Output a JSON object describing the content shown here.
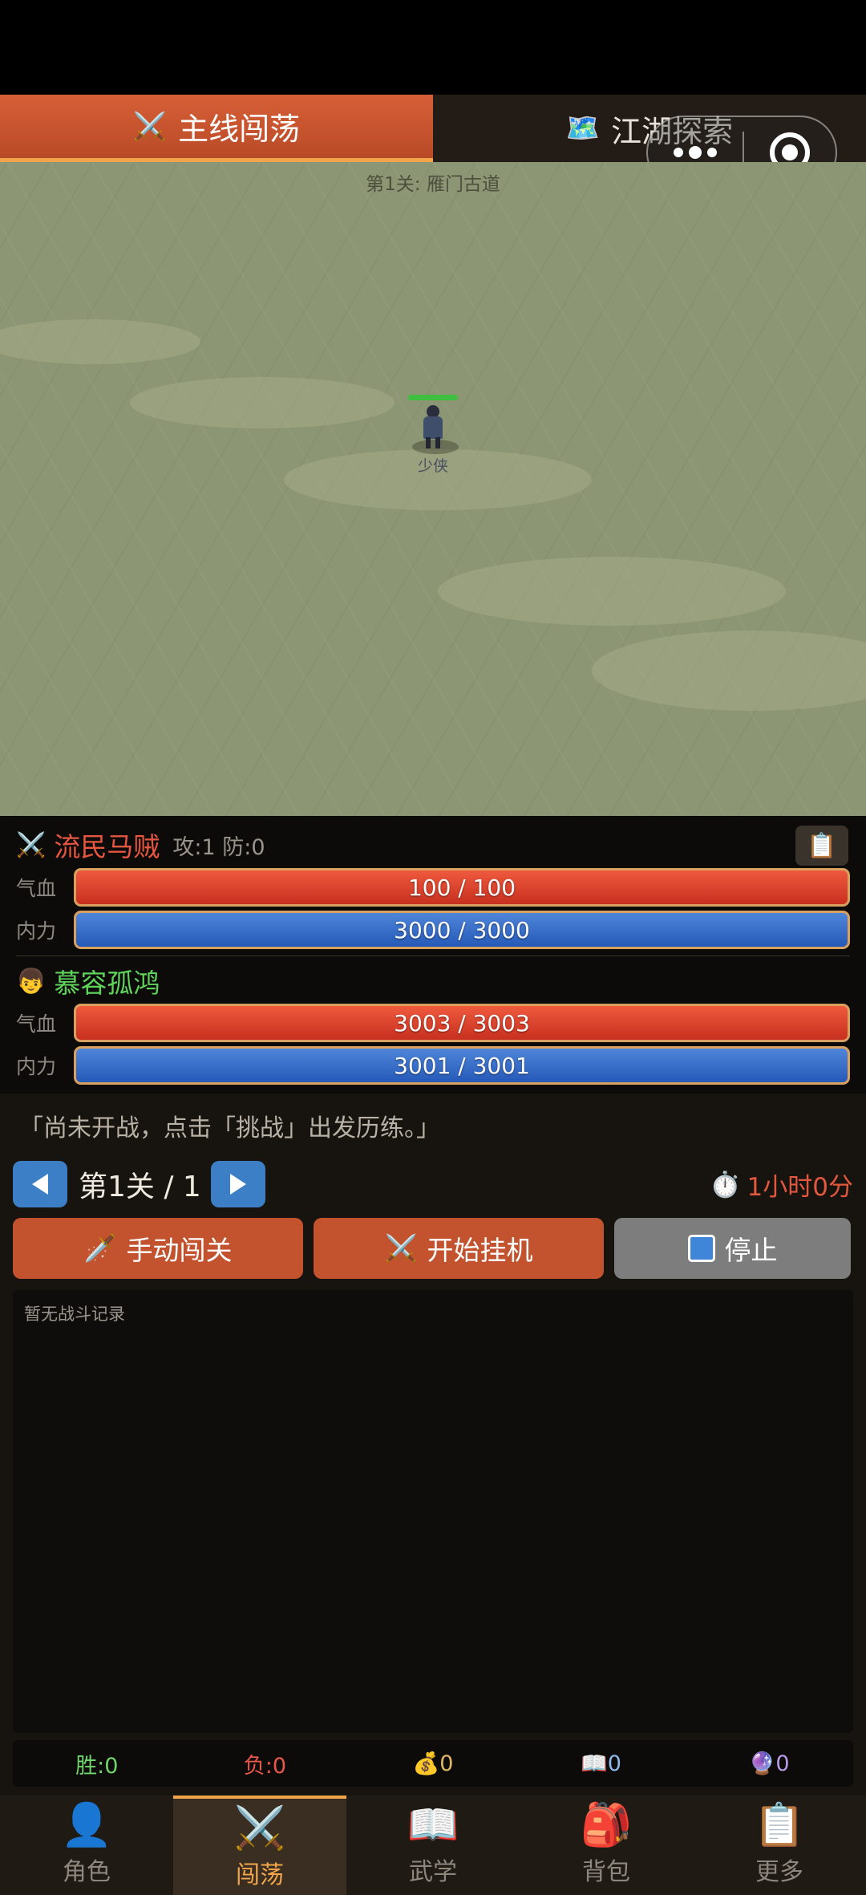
{
  "tabs": [
    {
      "icon": "⚔️",
      "label": "主线闯荡",
      "active": true
    },
    {
      "icon": "🗺️",
      "label": "江湖探索",
      "active": false
    }
  ],
  "field": {
    "stage_title": "第1关: 雁门古道",
    "hero_name": "少侠"
  },
  "enemy": {
    "icon": "⚔️",
    "name": "流民马贼",
    "stats": "攻:1 防:0",
    "hp_label": "气血",
    "hp": "100 / 100",
    "mp_label": "内力",
    "mp": "3000 / 3000"
  },
  "player": {
    "icon": "👦",
    "name": "慕容孤鸿",
    "hp_label": "气血",
    "hp": "3003 / 3003",
    "mp_label": "内力",
    "mp": "3001 / 3001"
  },
  "log_icon": "📋",
  "message": "「尚未开战，点击「挑战」出发历练。」",
  "stage_nav": {
    "label": "第1关 / 1",
    "timer_icon": "⏱️",
    "timer": "1小时0分"
  },
  "actions": {
    "manual_icon": "🗡️",
    "manual": "手动闯关",
    "idle_icon": "⚔️",
    "idle": "开始挂机",
    "stop": "停止"
  },
  "battle_log": {
    "empty": "暂无战斗记录"
  },
  "stats": {
    "win": "胜:0",
    "lose": "负:0",
    "gold": "💰0",
    "books": "📖0",
    "orbs": "🔮0"
  },
  "bottom_nav": [
    {
      "icon": "👤",
      "label": "角色",
      "active": false
    },
    {
      "icon": "⚔️",
      "label": "闯荡",
      "active": true
    },
    {
      "icon": "📖",
      "label": "武学",
      "active": false
    },
    {
      "icon": "🎒",
      "label": "背包",
      "active": false
    },
    {
      "icon": "📋",
      "label": "更多",
      "active": false
    }
  ]
}
